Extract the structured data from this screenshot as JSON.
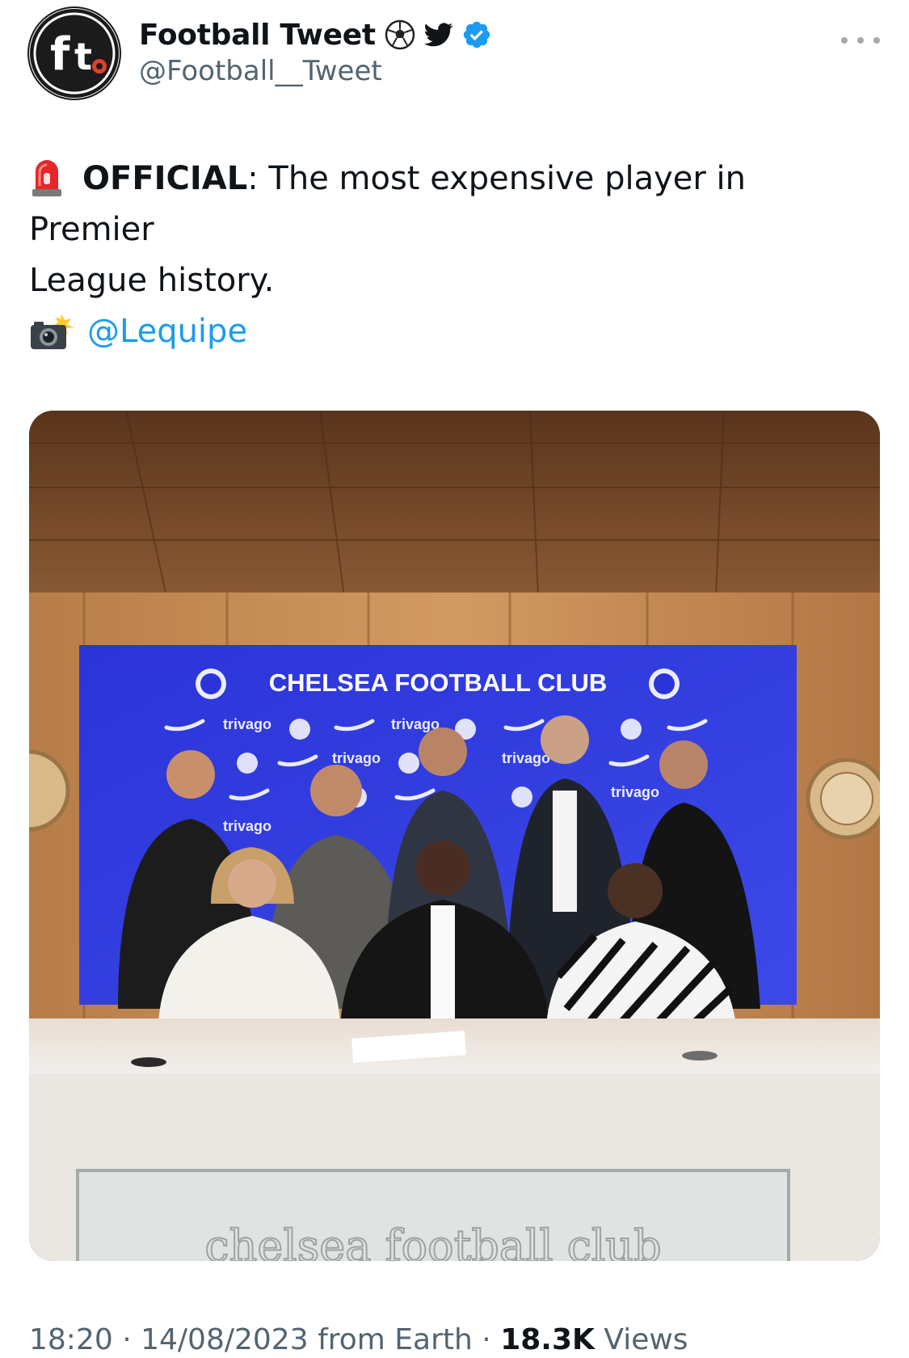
{
  "author": {
    "display_name": "Football Tweet",
    "handle": "@Football__Tweet",
    "avatar_text": "ft.",
    "badges": [
      "soccer-ball-icon",
      "twitter-bird-icon",
      "verified-badge-icon"
    ],
    "verified_color": "#1d9bf0"
  },
  "tweet": {
    "lead_emoji": "siren-icon",
    "official_label": "OFFICIAL",
    "colon": ":",
    "text_line1": " The most expensive player in Premier",
    "text_line2": "League history.",
    "photo_emoji": "camera-flash-icon",
    "mention": "@Lequipe"
  },
  "media": {
    "backdrop_title": "CHELSEA FOOTBALL CLUB",
    "sponsor": "trivago",
    "desk_engraving": "chelsea football club"
  },
  "footer": {
    "time": "18:20",
    "separator": "·",
    "date": "14/08/2023",
    "source": "from Earth",
    "views_count": "18.3K",
    "views_label": "Views"
  },
  "colors": {
    "text": "#0f1419",
    "secondary": "#536471",
    "link": "#1d9bf0"
  }
}
